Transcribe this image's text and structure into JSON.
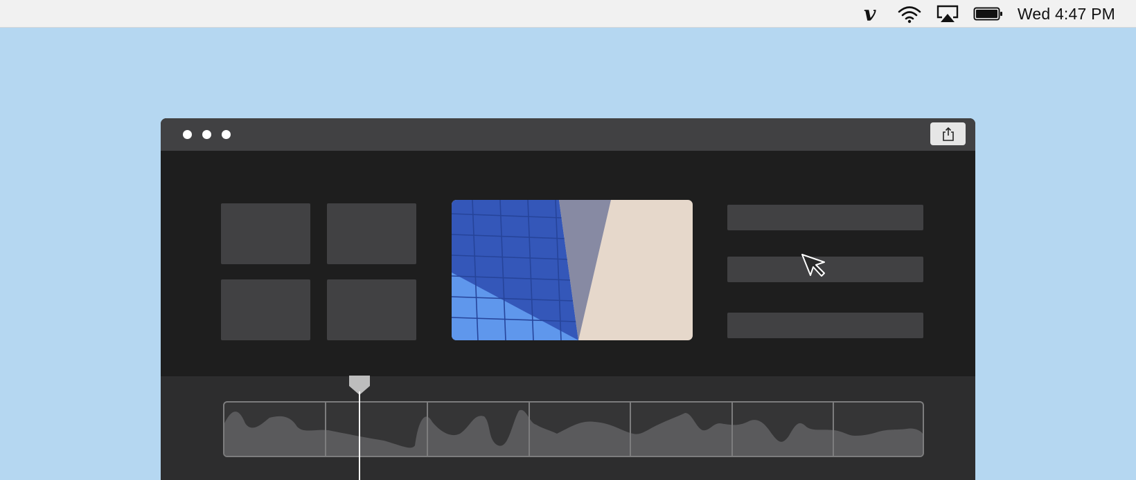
{
  "menubar": {
    "icons": [
      "vimeo-icon",
      "wifi-icon",
      "airplay-icon",
      "battery-icon"
    ],
    "clock": "Wed 4:47 PM"
  },
  "window": {
    "traffic_lights": 3,
    "share_icon": "share-icon",
    "library_tiles": 4,
    "list_rows": 3,
    "filmstrip_frames": 7,
    "colors": {
      "desktop": "#b5d7f1",
      "titlebar": "#414143",
      "content": "#1e1e1e",
      "timeline": "#2d2d2e",
      "preview_blue": "#3457b9",
      "preview_sand": "#e6d8cb"
    }
  }
}
